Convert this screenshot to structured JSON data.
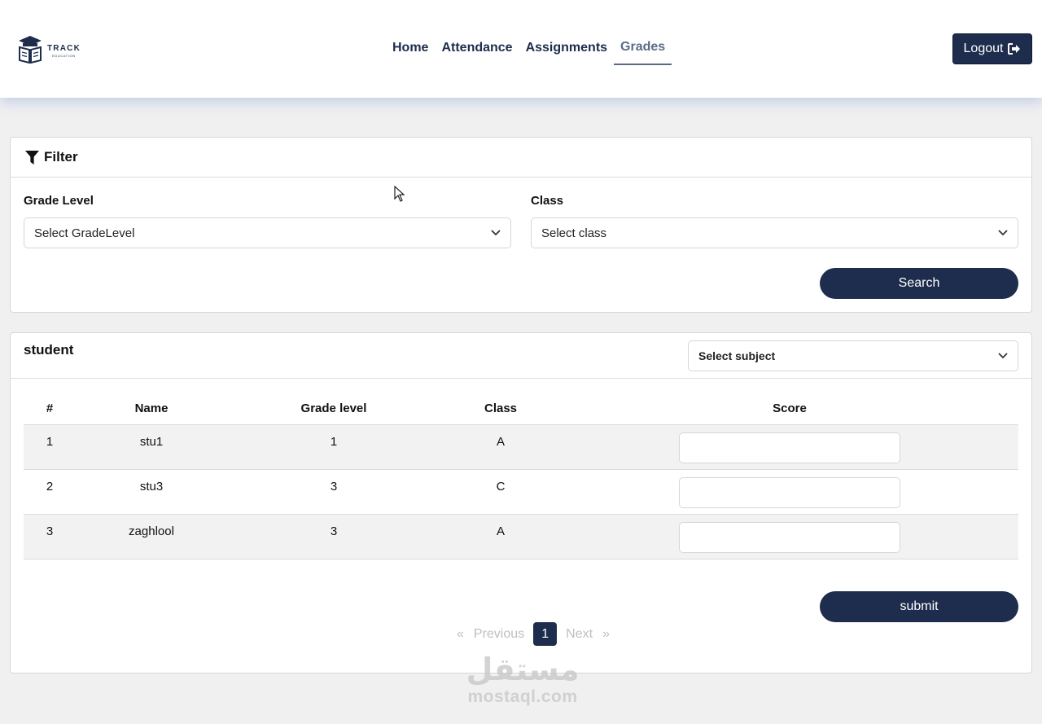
{
  "header": {
    "logo_text": "TRACK",
    "logo_sub": "EDUCATION",
    "nav": [
      {
        "label": "Home",
        "active": false
      },
      {
        "label": "Attendance",
        "active": false
      },
      {
        "label": "Assignments",
        "active": false
      },
      {
        "label": "Grades",
        "active": true
      }
    ],
    "logout_label": "Logout",
    "logout_icon": "sign-out-icon"
  },
  "filter": {
    "title": "Filter",
    "icon": "filter-icon",
    "grade_level_label": "Grade Level",
    "grade_level_value": "Select GradeLevel",
    "class_label": "Class",
    "class_value": "Select class",
    "search_label": "Search"
  },
  "student": {
    "title": "student",
    "subject_value": "Select subject",
    "columns": [
      "#",
      "Name",
      "Grade level",
      "Class",
      "Score"
    ],
    "rows": [
      {
        "num": "1",
        "name": "stu1",
        "grade": "1",
        "class": "A",
        "score": ""
      },
      {
        "num": "2",
        "name": "stu3",
        "grade": "3",
        "class": "C",
        "score": ""
      },
      {
        "num": "3",
        "name": "zaghlool",
        "grade": "3",
        "class": "A",
        "score": ""
      }
    ],
    "submit_label": "submit"
  },
  "pagination": {
    "first": "«",
    "previous": "Previous",
    "current": "1",
    "next": "Next",
    "last": "»"
  },
  "watermark": {
    "arabic": "مستقل",
    "latin": "mostaql.com"
  },
  "colors": {
    "primary": "#1e2d4d",
    "active_nav": "#5a6b86",
    "background": "#f0f0f1"
  }
}
